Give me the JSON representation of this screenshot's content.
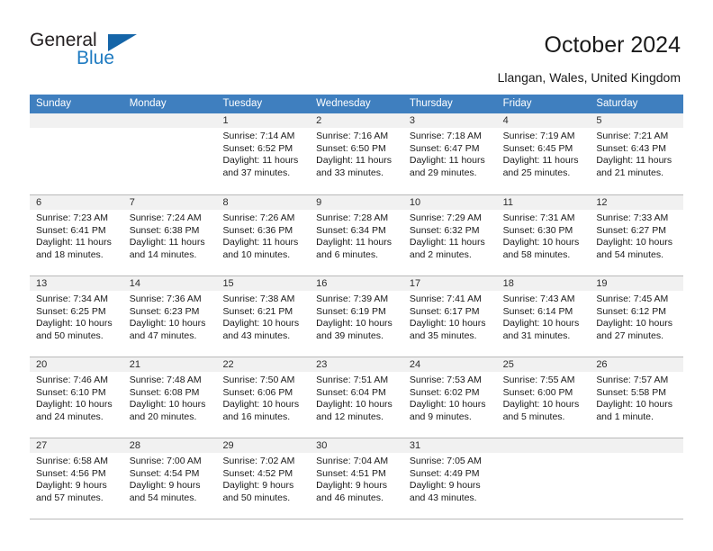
{
  "brand": {
    "name_top": "General",
    "name_bottom": "Blue",
    "accent_color": "#1f7bc1",
    "triangle_color": "#1565a8"
  },
  "header": {
    "title": "October 2024",
    "subtitle": "Llangan, Wales, United Kingdom"
  },
  "calendar": {
    "header_bg": "#3f7fbf",
    "weekdays": [
      "Sunday",
      "Monday",
      "Tuesday",
      "Wednesday",
      "Thursday",
      "Friday",
      "Saturday"
    ],
    "weeks": [
      [
        {
          "day": "",
          "lines": []
        },
        {
          "day": "",
          "lines": []
        },
        {
          "day": "1",
          "lines": [
            "Sunrise: 7:14 AM",
            "Sunset: 6:52 PM",
            "Daylight: 11 hours",
            "and 37 minutes."
          ]
        },
        {
          "day": "2",
          "lines": [
            "Sunrise: 7:16 AM",
            "Sunset: 6:50 PM",
            "Daylight: 11 hours",
            "and 33 minutes."
          ]
        },
        {
          "day": "3",
          "lines": [
            "Sunrise: 7:18 AM",
            "Sunset: 6:47 PM",
            "Daylight: 11 hours",
            "and 29 minutes."
          ]
        },
        {
          "day": "4",
          "lines": [
            "Sunrise: 7:19 AM",
            "Sunset: 6:45 PM",
            "Daylight: 11 hours",
            "and 25 minutes."
          ]
        },
        {
          "day": "5",
          "lines": [
            "Sunrise: 7:21 AM",
            "Sunset: 6:43 PM",
            "Daylight: 11 hours",
            "and 21 minutes."
          ]
        }
      ],
      [
        {
          "day": "6",
          "lines": [
            "Sunrise: 7:23 AM",
            "Sunset: 6:41 PM",
            "Daylight: 11 hours",
            "and 18 minutes."
          ]
        },
        {
          "day": "7",
          "lines": [
            "Sunrise: 7:24 AM",
            "Sunset: 6:38 PM",
            "Daylight: 11 hours",
            "and 14 minutes."
          ]
        },
        {
          "day": "8",
          "lines": [
            "Sunrise: 7:26 AM",
            "Sunset: 6:36 PM",
            "Daylight: 11 hours",
            "and 10 minutes."
          ]
        },
        {
          "day": "9",
          "lines": [
            "Sunrise: 7:28 AM",
            "Sunset: 6:34 PM",
            "Daylight: 11 hours",
            "and 6 minutes."
          ]
        },
        {
          "day": "10",
          "lines": [
            "Sunrise: 7:29 AM",
            "Sunset: 6:32 PM",
            "Daylight: 11 hours",
            "and 2 minutes."
          ]
        },
        {
          "day": "11",
          "lines": [
            "Sunrise: 7:31 AM",
            "Sunset: 6:30 PM",
            "Daylight: 10 hours",
            "and 58 minutes."
          ]
        },
        {
          "day": "12",
          "lines": [
            "Sunrise: 7:33 AM",
            "Sunset: 6:27 PM",
            "Daylight: 10 hours",
            "and 54 minutes."
          ]
        }
      ],
      [
        {
          "day": "13",
          "lines": [
            "Sunrise: 7:34 AM",
            "Sunset: 6:25 PM",
            "Daylight: 10 hours",
            "and 50 minutes."
          ]
        },
        {
          "day": "14",
          "lines": [
            "Sunrise: 7:36 AM",
            "Sunset: 6:23 PM",
            "Daylight: 10 hours",
            "and 47 minutes."
          ]
        },
        {
          "day": "15",
          "lines": [
            "Sunrise: 7:38 AM",
            "Sunset: 6:21 PM",
            "Daylight: 10 hours",
            "and 43 minutes."
          ]
        },
        {
          "day": "16",
          "lines": [
            "Sunrise: 7:39 AM",
            "Sunset: 6:19 PM",
            "Daylight: 10 hours",
            "and 39 minutes."
          ]
        },
        {
          "day": "17",
          "lines": [
            "Sunrise: 7:41 AM",
            "Sunset: 6:17 PM",
            "Daylight: 10 hours",
            "and 35 minutes."
          ]
        },
        {
          "day": "18",
          "lines": [
            "Sunrise: 7:43 AM",
            "Sunset: 6:14 PM",
            "Daylight: 10 hours",
            "and 31 minutes."
          ]
        },
        {
          "day": "19",
          "lines": [
            "Sunrise: 7:45 AM",
            "Sunset: 6:12 PM",
            "Daylight: 10 hours",
            "and 27 minutes."
          ]
        }
      ],
      [
        {
          "day": "20",
          "lines": [
            "Sunrise: 7:46 AM",
            "Sunset: 6:10 PM",
            "Daylight: 10 hours",
            "and 24 minutes."
          ]
        },
        {
          "day": "21",
          "lines": [
            "Sunrise: 7:48 AM",
            "Sunset: 6:08 PM",
            "Daylight: 10 hours",
            "and 20 minutes."
          ]
        },
        {
          "day": "22",
          "lines": [
            "Sunrise: 7:50 AM",
            "Sunset: 6:06 PM",
            "Daylight: 10 hours",
            "and 16 minutes."
          ]
        },
        {
          "day": "23",
          "lines": [
            "Sunrise: 7:51 AM",
            "Sunset: 6:04 PM",
            "Daylight: 10 hours",
            "and 12 minutes."
          ]
        },
        {
          "day": "24",
          "lines": [
            "Sunrise: 7:53 AM",
            "Sunset: 6:02 PM",
            "Daylight: 10 hours",
            "and 9 minutes."
          ]
        },
        {
          "day": "25",
          "lines": [
            "Sunrise: 7:55 AM",
            "Sunset: 6:00 PM",
            "Daylight: 10 hours",
            "and 5 minutes."
          ]
        },
        {
          "day": "26",
          "lines": [
            "Sunrise: 7:57 AM",
            "Sunset: 5:58 PM",
            "Daylight: 10 hours",
            "and 1 minute."
          ]
        }
      ],
      [
        {
          "day": "27",
          "lines": [
            "Sunrise: 6:58 AM",
            "Sunset: 4:56 PM",
            "Daylight: 9 hours",
            "and 57 minutes."
          ]
        },
        {
          "day": "28",
          "lines": [
            "Sunrise: 7:00 AM",
            "Sunset: 4:54 PM",
            "Daylight: 9 hours",
            "and 54 minutes."
          ]
        },
        {
          "day": "29",
          "lines": [
            "Sunrise: 7:02 AM",
            "Sunset: 4:52 PM",
            "Daylight: 9 hours",
            "and 50 minutes."
          ]
        },
        {
          "day": "30",
          "lines": [
            "Sunrise: 7:04 AM",
            "Sunset: 4:51 PM",
            "Daylight: 9 hours",
            "and 46 minutes."
          ]
        },
        {
          "day": "31",
          "lines": [
            "Sunrise: 7:05 AM",
            "Sunset: 4:49 PM",
            "Daylight: 9 hours",
            "and 43 minutes."
          ]
        },
        {
          "day": "",
          "lines": []
        },
        {
          "day": "",
          "lines": []
        }
      ]
    ]
  }
}
